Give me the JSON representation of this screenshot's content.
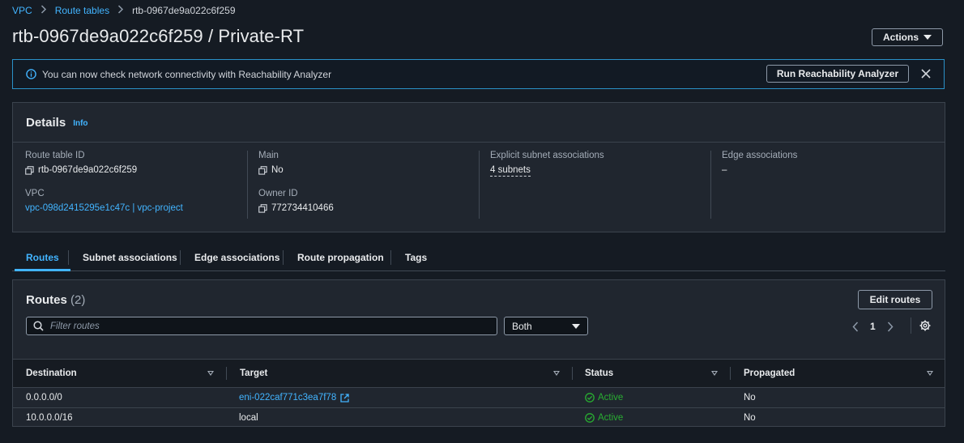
{
  "breadcrumb": {
    "vpc": "VPC",
    "route_tables": "Route tables",
    "current": "rtb-0967de9a022c6f259"
  },
  "page_title": "rtb-0967de9a022c6f259 / Private-RT",
  "actions_label": "Actions",
  "flash": {
    "message": "You can now check network connectivity with Reachability Analyzer",
    "button": "Run Reachability Analyzer"
  },
  "details": {
    "title": "Details",
    "info": "Info",
    "route_table_id_label": "Route table ID",
    "route_table_id": "rtb-0967de9a022c6f259",
    "vpc_label": "VPC",
    "vpc": "vpc-098d2415295e1c47c | vpc-project",
    "main_label": "Main",
    "main": "No",
    "owner_label": "Owner ID",
    "owner": "772734410466",
    "explicit_label": "Explicit subnet associations",
    "explicit": "4 subnets",
    "edge_label": "Edge associations",
    "edge": "–"
  },
  "tabs": [
    "Routes",
    "Subnet associations",
    "Edge associations",
    "Route propagation",
    "Tags"
  ],
  "routes": {
    "title": "Routes",
    "count": "(2)",
    "edit_label": "Edit routes",
    "filter_placeholder": "Filter routes",
    "select_value": "Both",
    "page": "1",
    "columns": [
      "Destination",
      "Target",
      "Status",
      "Propagated"
    ],
    "rows": [
      {
        "destination": "0.0.0.0/0",
        "target": "eni-022caf771c3ea7f78",
        "target_is_link": true,
        "status": "Active",
        "propagated": "No"
      },
      {
        "destination": "10.0.0.0/16",
        "target": "local",
        "target_is_link": false,
        "status": "Active",
        "propagated": "No"
      }
    ]
  },
  "colors": {
    "link": "#42b4ff",
    "success": "#29ad32",
    "info_border": "#2a91c8"
  }
}
